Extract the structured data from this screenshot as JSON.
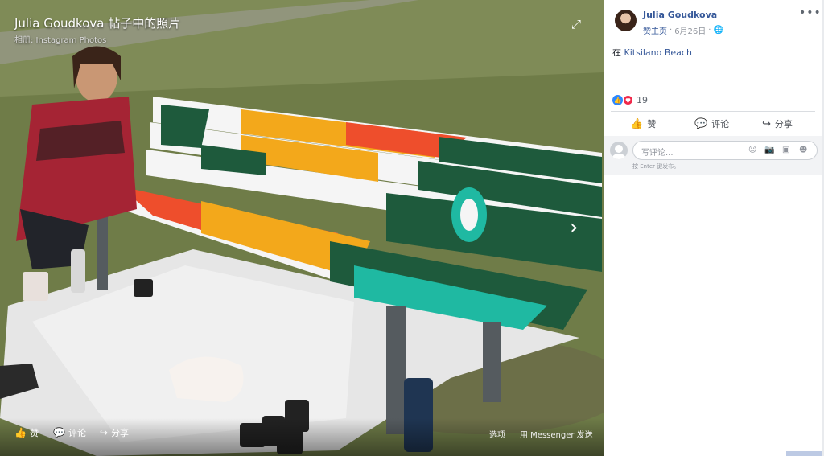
{
  "photo": {
    "title": "Julia Goudkova 帖子中的照片",
    "subtitle": "相册: Instagram Photos",
    "actions": {
      "like": "赞",
      "comment": "评论",
      "share": "分享"
    },
    "options": "选项",
    "messenger": "用 Messenger 发送"
  },
  "post": {
    "author": "Julia Goudkova",
    "meta_link": "赞主页",
    "date": "6月26日",
    "location_prefix": "在",
    "location": "Kitsilano Beach",
    "reaction_count": "19",
    "actions": {
      "like": "赞",
      "comment": "评论",
      "share": "分享"
    },
    "comment_placeholder": "写评论...",
    "comment_hint": "按 Enter 键发布。"
  },
  "icons": {
    "expand": "expand-icon",
    "next": "chevron-right-icon",
    "more": "more-options-icon",
    "globe": "globe-icon",
    "like": "thumbs-up-icon",
    "comment": "comment-icon",
    "share": "share-icon"
  },
  "colors": {
    "link": "#365899",
    "like": "#2d88ff",
    "love": "#f0284a"
  }
}
